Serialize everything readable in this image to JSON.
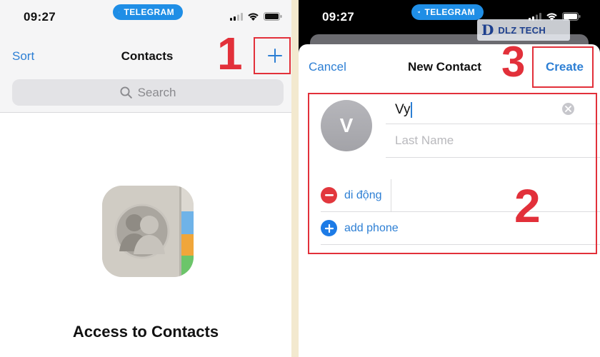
{
  "left_screen": {
    "status": {
      "time": "09:27",
      "telegram_pill": "TELEGRAM"
    },
    "nav": {
      "sort_label": "Sort",
      "title": "Contacts"
    },
    "search": {
      "placeholder": "Search"
    },
    "empty_state": {
      "heading": "Access to Contacts"
    },
    "step_label": "1"
  },
  "right_screen": {
    "status": {
      "time": "09:27",
      "telegram_pill": "TELEGRAM"
    },
    "nav": {
      "cancel_label": "Cancel",
      "title": "New Contact",
      "create_label": "Create"
    },
    "form": {
      "avatar_initial": "V",
      "first_name_value": "Vy",
      "last_name_placeholder": "Last Name",
      "phone_label": "di động",
      "add_phone_label": "add phone"
    },
    "step_labels": {
      "form": "2",
      "create": "3"
    },
    "watermark": {
      "mark": "D",
      "text": "DLZ TECH"
    }
  },
  "colors": {
    "ios_blue": "#2d7fd4",
    "annotation_red": "#e2303a",
    "telegram_blue": "#1f8ee6",
    "delete_red": "#e2373d",
    "add_blue": "#1d7be6"
  },
  "icons": [
    "telegram-icon",
    "signal-icon",
    "wifi-icon",
    "battery-icon",
    "plus-icon",
    "search-icon",
    "contacts-app-icon",
    "clear-icon",
    "minus-circle-icon",
    "plus-circle-icon"
  ]
}
